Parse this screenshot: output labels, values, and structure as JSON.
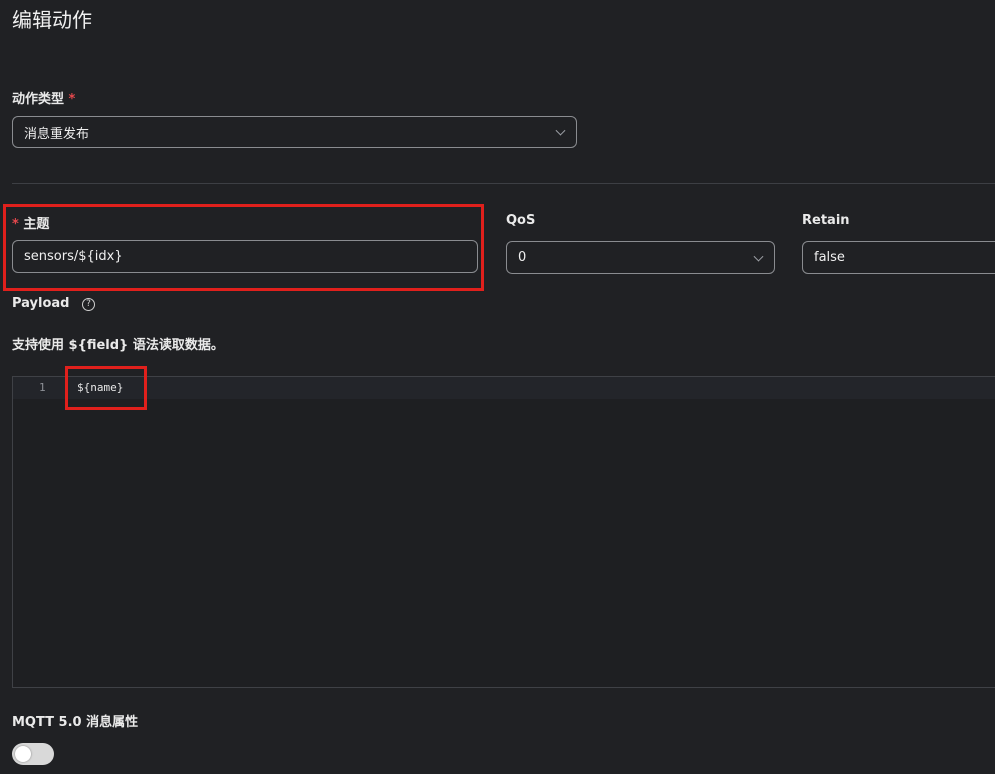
{
  "page": {
    "title": "编辑动作"
  },
  "action_type": {
    "label": "动作类型",
    "required_mark": "*",
    "value": "消息重发布"
  },
  "topic": {
    "required_mark": "*",
    "label": "主题",
    "value": "sensors/${idx}"
  },
  "qos": {
    "label": "QoS",
    "value": "0"
  },
  "retain": {
    "label": "Retain",
    "value": "false"
  },
  "payload": {
    "label": "Payload",
    "help_icon": "?",
    "hint": "支持使用 ${field} 语法读取数据。",
    "editor": {
      "line_numbers": [
        "1"
      ],
      "lines": [
        "${name}"
      ]
    }
  },
  "mqtt5": {
    "label": "MQTT 5.0 消息属性",
    "toggle_on": false
  },
  "icons": {
    "select_arrow": "chevron-down-icon",
    "help": "question-circle-icon"
  },
  "colors": {
    "background": "#202124",
    "highlight": "#e0201c",
    "required": "#e5484d"
  }
}
